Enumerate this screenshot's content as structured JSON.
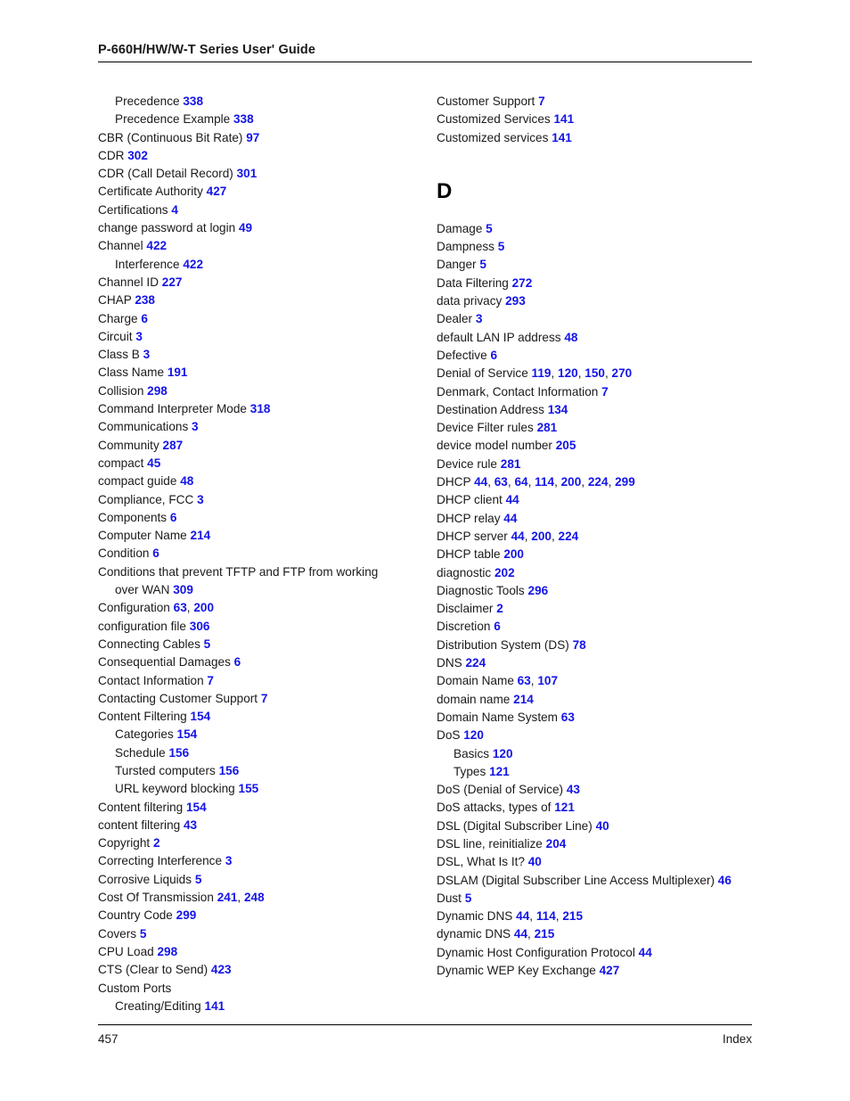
{
  "header": {
    "title": "P-660H/HW/W-T Series User' Guide"
  },
  "footer": {
    "page_number": "457",
    "section_label": "Index"
  },
  "colors": {
    "page_number_link": "#1414e8",
    "text": "#1a1a1a"
  },
  "columns": {
    "left": [
      {
        "level": 2,
        "text": "Precedence",
        "pages": [
          "338"
        ]
      },
      {
        "level": 2,
        "text": "Precedence Example",
        "pages": [
          "338"
        ]
      },
      {
        "level": 1,
        "text": "CBR (Continuous Bit Rate)",
        "pages": [
          "97"
        ]
      },
      {
        "level": 1,
        "text": "CDR",
        "pages": [
          "302"
        ]
      },
      {
        "level": 1,
        "text": "CDR (Call Detail Record)",
        "pages": [
          "301"
        ]
      },
      {
        "level": 1,
        "text": "Certificate Authority",
        "pages": [
          "427"
        ]
      },
      {
        "level": 1,
        "text": "Certifications",
        "pages": [
          "4"
        ]
      },
      {
        "level": 1,
        "text": "change password at login",
        "pages": [
          "49"
        ]
      },
      {
        "level": 1,
        "text": "Channel",
        "pages": [
          "422"
        ]
      },
      {
        "level": 2,
        "text": "Interference",
        "pages": [
          "422"
        ]
      },
      {
        "level": 1,
        "text": "Channel ID",
        "pages": [
          "227"
        ]
      },
      {
        "level": 1,
        "text": "CHAP",
        "pages": [
          "238"
        ]
      },
      {
        "level": 1,
        "text": "Charge",
        "pages": [
          "6"
        ]
      },
      {
        "level": 1,
        "text": "Circuit",
        "pages": [
          "3"
        ]
      },
      {
        "level": 1,
        "text": "Class B",
        "pages": [
          "3"
        ]
      },
      {
        "level": 1,
        "text": "Class Name",
        "pages": [
          "191"
        ]
      },
      {
        "level": 1,
        "text": "Collision",
        "pages": [
          "298"
        ]
      },
      {
        "level": 1,
        "text": "Command Interpreter Mode",
        "pages": [
          "318"
        ]
      },
      {
        "level": 1,
        "text": "Communications",
        "pages": [
          "3"
        ]
      },
      {
        "level": 1,
        "text": "Community",
        "pages": [
          "287"
        ]
      },
      {
        "level": 1,
        "text": "compact",
        "pages": [
          "45"
        ]
      },
      {
        "level": 1,
        "text": "compact guide",
        "pages": [
          "48"
        ]
      },
      {
        "level": 1,
        "text": "Compliance, FCC",
        "pages": [
          "3"
        ]
      },
      {
        "level": 1,
        "text": "Components",
        "pages": [
          "6"
        ]
      },
      {
        "level": 1,
        "text": "Computer Name",
        "pages": [
          "214"
        ]
      },
      {
        "level": 1,
        "text": "Condition",
        "pages": [
          "6"
        ]
      },
      {
        "level": 1,
        "wrapped": true,
        "line1": "Conditions that prevent TFTP and FTP from working",
        "line2": "over WAN",
        "pages": [
          "309"
        ]
      },
      {
        "level": 1,
        "text": "Configuration",
        "pages": [
          "63",
          "200"
        ]
      },
      {
        "level": 1,
        "text": "configuration file",
        "pages": [
          "306"
        ]
      },
      {
        "level": 1,
        "text": "Connecting Cables",
        "pages": [
          "5"
        ]
      },
      {
        "level": 1,
        "text": "Consequential Damages",
        "pages": [
          "6"
        ]
      },
      {
        "level": 1,
        "text": "Contact Information",
        "pages": [
          "7"
        ]
      },
      {
        "level": 1,
        "text": "Contacting Customer Support",
        "pages": [
          "7"
        ]
      },
      {
        "level": 1,
        "text": "Content Filtering",
        "pages": [
          "154"
        ]
      },
      {
        "level": 2,
        "text": "Categories",
        "pages": [
          "154"
        ]
      },
      {
        "level": 2,
        "text": "Schedule",
        "pages": [
          "156"
        ]
      },
      {
        "level": 2,
        "text": "Tursted computers",
        "pages": [
          "156"
        ]
      },
      {
        "level": 2,
        "text": "URL keyword blocking",
        "pages": [
          "155"
        ]
      },
      {
        "level": 1,
        "text": "Content filtering",
        "pages": [
          "154"
        ]
      },
      {
        "level": 1,
        "text": "content filtering",
        "pages": [
          "43"
        ]
      },
      {
        "level": 1,
        "text": "Copyright",
        "pages": [
          "2"
        ]
      },
      {
        "level": 1,
        "text": "Correcting Interference",
        "pages": [
          "3"
        ]
      },
      {
        "level": 1,
        "text": "Corrosive Liquids",
        "pages": [
          "5"
        ]
      },
      {
        "level": 1,
        "text": "Cost Of Transmission",
        "pages": [
          "241",
          "248"
        ]
      },
      {
        "level": 1,
        "text": "Country Code",
        "pages": [
          "299"
        ]
      },
      {
        "level": 1,
        "text": "Covers",
        "pages": [
          "5"
        ]
      },
      {
        "level": 1,
        "text": "CPU Load",
        "pages": [
          "298"
        ]
      },
      {
        "level": 1,
        "text": "CTS (Clear to Send)",
        "pages": [
          "423"
        ]
      },
      {
        "level": 1,
        "text": "Custom Ports",
        "pages": []
      },
      {
        "level": 2,
        "text": "Creating/Editing",
        "pages": [
          "141"
        ]
      }
    ],
    "right": [
      {
        "level": 1,
        "text": "Customer Support",
        "pages": [
          "7"
        ]
      },
      {
        "level": 1,
        "text": "Customized Services",
        "pages": [
          "141"
        ]
      },
      {
        "level": 1,
        "text": "Customized services",
        "pages": [
          "141"
        ]
      },
      {
        "heading": "D"
      },
      {
        "level": 1,
        "text": "Damage",
        "pages": [
          "5"
        ]
      },
      {
        "level": 1,
        "text": "Dampness",
        "pages": [
          "5"
        ]
      },
      {
        "level": 1,
        "text": "Danger",
        "pages": [
          "5"
        ]
      },
      {
        "level": 1,
        "text": "Data Filtering",
        "pages": [
          "272"
        ]
      },
      {
        "level": 1,
        "text": "data privacy",
        "pages": [
          "293"
        ]
      },
      {
        "level": 1,
        "text": "Dealer",
        "pages": [
          "3"
        ]
      },
      {
        "level": 1,
        "text": "default LAN IP address",
        "pages": [
          "48"
        ]
      },
      {
        "level": 1,
        "text": "Defective",
        "pages": [
          "6"
        ]
      },
      {
        "level": 1,
        "text": "Denial of Service",
        "pages": [
          "119",
          "120",
          "150",
          "270"
        ]
      },
      {
        "level": 1,
        "text": "Denmark, Contact Information",
        "pages": [
          "7"
        ]
      },
      {
        "level": 1,
        "text": "Destination Address",
        "pages": [
          "134"
        ]
      },
      {
        "level": 1,
        "text": "Device Filter rules",
        "pages": [
          "281"
        ]
      },
      {
        "level": 1,
        "text": "device model number",
        "pages": [
          "205"
        ]
      },
      {
        "level": 1,
        "text": "Device rule",
        "pages": [
          "281"
        ]
      },
      {
        "level": 1,
        "text": "DHCP",
        "pages": [
          "44",
          "63",
          "64",
          "114",
          "200",
          "224",
          "299"
        ]
      },
      {
        "level": 1,
        "text": "DHCP client",
        "pages": [
          "44"
        ]
      },
      {
        "level": 1,
        "text": "DHCP relay",
        "pages": [
          "44"
        ]
      },
      {
        "level": 1,
        "text": "DHCP server",
        "pages": [
          "44",
          "200",
          "224"
        ]
      },
      {
        "level": 1,
        "text": "DHCP table",
        "pages": [
          "200"
        ]
      },
      {
        "level": 1,
        "text": "diagnostic",
        "pages": [
          "202"
        ]
      },
      {
        "level": 1,
        "text": "Diagnostic Tools",
        "pages": [
          "296"
        ]
      },
      {
        "level": 1,
        "text": "Disclaimer",
        "pages": [
          "2"
        ]
      },
      {
        "level": 1,
        "text": "Discretion",
        "pages": [
          "6"
        ]
      },
      {
        "level": 1,
        "text": "Distribution System (DS)",
        "pages": [
          "78"
        ]
      },
      {
        "level": 1,
        "text": "DNS",
        "pages": [
          "224"
        ]
      },
      {
        "level": 1,
        "text": "Domain Name",
        "pages": [
          "63",
          "107"
        ]
      },
      {
        "level": 1,
        "text": "domain name",
        "pages": [
          "214"
        ]
      },
      {
        "level": 1,
        "text": "Domain Name System",
        "pages": [
          "63"
        ]
      },
      {
        "level": 1,
        "text": "DoS",
        "pages": [
          "120"
        ]
      },
      {
        "level": 2,
        "text": "Basics",
        "pages": [
          "120"
        ]
      },
      {
        "level": 2,
        "text": "Types",
        "pages": [
          "121"
        ]
      },
      {
        "level": 1,
        "text": "DoS (Denial of Service)",
        "pages": [
          "43"
        ]
      },
      {
        "level": 1,
        "text": "DoS attacks, types of",
        "pages": [
          "121"
        ]
      },
      {
        "level": 1,
        "text": "DSL (Digital Subscriber Line)",
        "pages": [
          "40"
        ]
      },
      {
        "level": 1,
        "text": "DSL line, reinitialize",
        "pages": [
          "204"
        ]
      },
      {
        "level": 1,
        "text": "DSL, What Is It?",
        "pages": [
          "40"
        ]
      },
      {
        "level": 1,
        "text": "DSLAM (Digital Subscriber Line Access Multiplexer)",
        "pages": [
          "46"
        ]
      },
      {
        "level": 1,
        "text": "Dust",
        "pages": [
          "5"
        ]
      },
      {
        "level": 1,
        "text": "Dynamic DNS",
        "pages": [
          "44",
          "114",
          "215"
        ]
      },
      {
        "level": 1,
        "text": "dynamic DNS",
        "pages": [
          "44",
          "215"
        ]
      },
      {
        "level": 1,
        "text": "Dynamic Host Configuration Protocol",
        "pages": [
          "44"
        ]
      },
      {
        "level": 1,
        "text": "Dynamic WEP Key Exchange",
        "pages": [
          "427"
        ]
      }
    ]
  }
}
